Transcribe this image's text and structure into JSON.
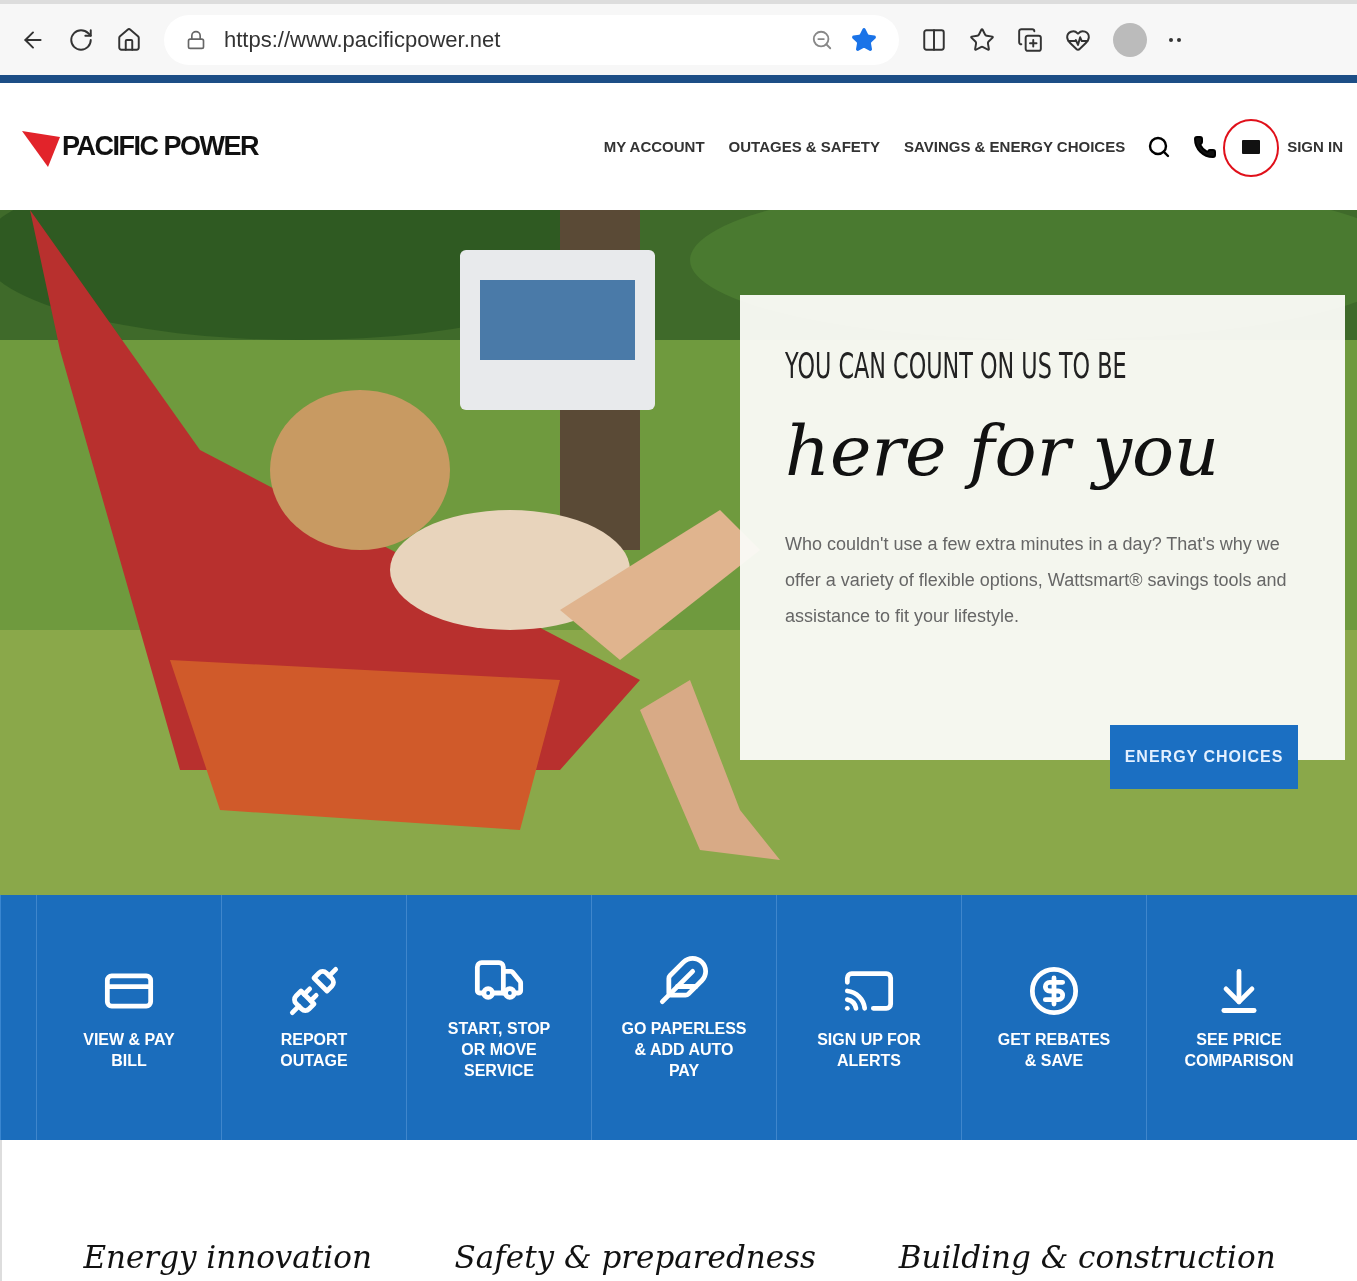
{
  "browser": {
    "url": "https://www.pacificpower.net"
  },
  "header": {
    "logo": "PACIFIC POWER",
    "nav": [
      {
        "label": "MY ACCOUNT"
      },
      {
        "label": "OUTAGES & SAFETY"
      },
      {
        "label": "SAVINGS & ENERGY CHOICES"
      }
    ],
    "sign_in": "SIGN IN"
  },
  "hero": {
    "kind": "picture",
    "eyebrow": "YOU CAN COUNT ON US TO BE",
    "headline": "here for you",
    "body": "Who couldn't use a few extra minutes in a day? That's why we offer a variety of flexible options, Wattsmart® savings tools and assistance to fit your lifestyle.",
    "button": "ENERGY CHOICES"
  },
  "tiles": [
    {
      "kind": "card",
      "label": "VIEW & PAY BILL"
    },
    {
      "kind": "unplug",
      "label": "REPORT OUTAGE"
    },
    {
      "kind": "truck",
      "label": "START, STOP OR MOVE SERVICE"
    },
    {
      "kind": "leaf",
      "label": "GO PAPERLESS & ADD AUTO PAY"
    },
    {
      "kind": "phone",
      "label": "SIGN UP FOR ALERTS"
    },
    {
      "kind": "dollar",
      "label": "GET REBATES & SAVE"
    },
    {
      "kind": "compare",
      "label": "SEE PRICE COMPARISON"
    }
  ],
  "sections": [
    {
      "title": "Energy innovation"
    },
    {
      "title": "Safety & preparedness"
    },
    {
      "title": "Building & construction"
    }
  ]
}
